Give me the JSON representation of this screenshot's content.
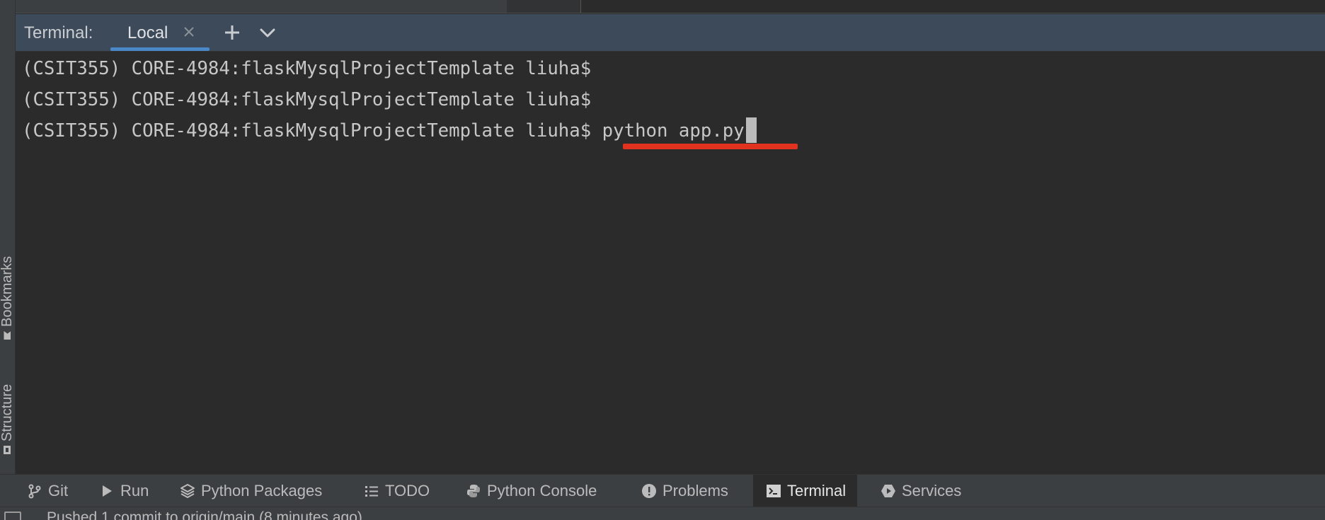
{
  "left_stripe": {
    "bookmarks_label": "Bookmarks",
    "structure_label": "Structure"
  },
  "terminal": {
    "title": "Terminal:",
    "tab_label": "Local",
    "lines": [
      {
        "prompt": "(CSIT355) CORE-4984:flaskMysqlProjectTemplate liuha$",
        "command": ""
      },
      {
        "prompt": "(CSIT355) CORE-4984:flaskMysqlProjectTemplate liuha$",
        "command": ""
      },
      {
        "prompt": "(CSIT355) CORE-4984:flaskMysqlProjectTemplate liuha$",
        "command": "python app.py"
      }
    ]
  },
  "bottom_bar": {
    "git": "Git",
    "run": "Run",
    "python_packages": "Python Packages",
    "todo": "TODO",
    "python_console": "Python Console",
    "problems": "Problems",
    "terminal": "Terminal",
    "services": "Services"
  },
  "status": {
    "text": "Pushed 1 commit to origin/main (8 minutes ago)"
  },
  "colors": {
    "accent_tab_underline": "#4a88c7",
    "annotation_red": "#e0321f",
    "terminal_bg": "#2b2b2b",
    "header_bg": "#3d4a5a"
  }
}
